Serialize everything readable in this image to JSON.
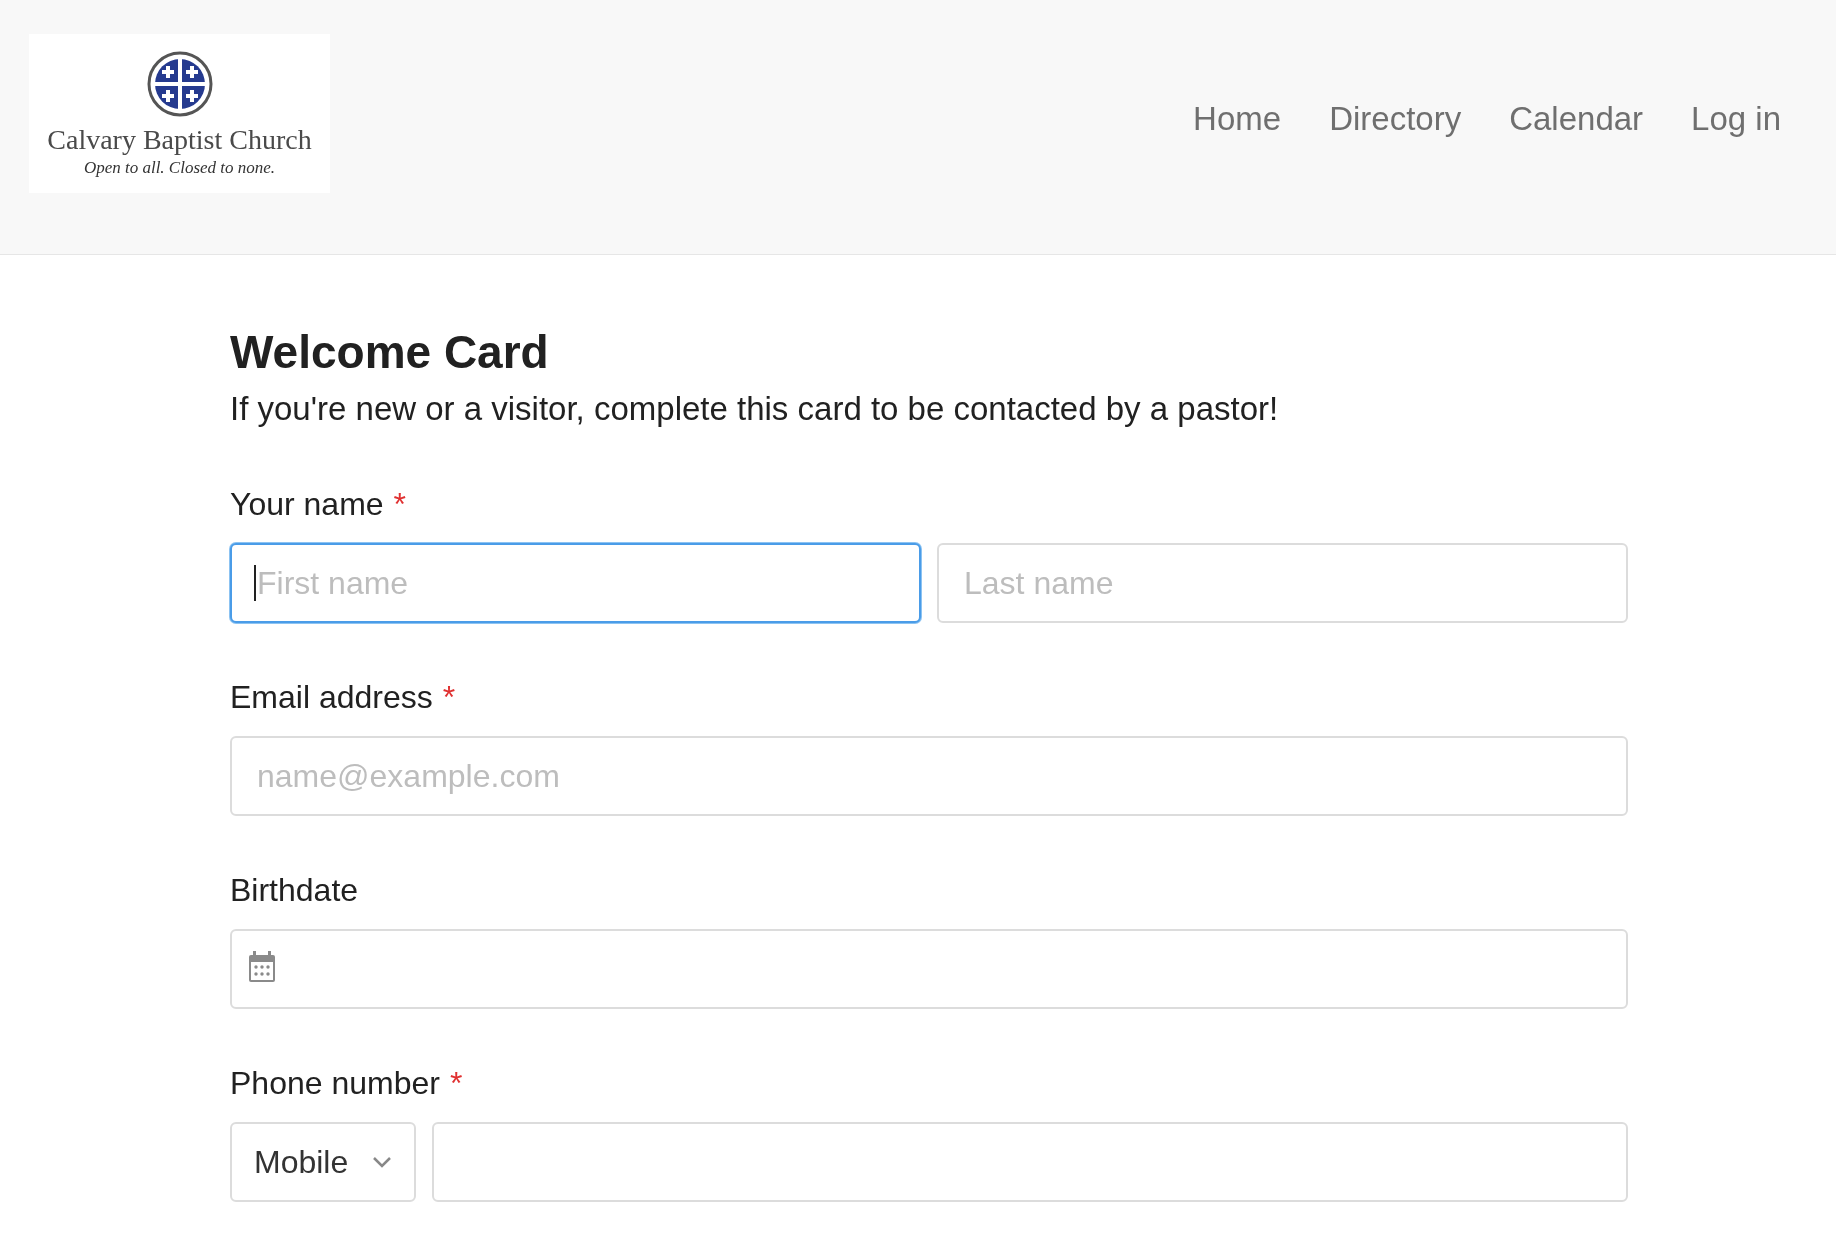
{
  "header": {
    "logo": {
      "name": "Calvary Baptist Church",
      "tagline": "Open to all. Closed to none."
    },
    "nav": [
      {
        "label": "Home"
      },
      {
        "label": "Directory"
      },
      {
        "label": "Calendar"
      },
      {
        "label": "Log in"
      }
    ]
  },
  "form": {
    "title": "Welcome Card",
    "intro": "If you're new or a visitor, complete this card to be contacted by a pastor!",
    "fields": [
      {
        "kind": "name",
        "label": "Your name",
        "required_mark": "*",
        "inputs": [
          {
            "placeholder": "First name",
            "focused": true
          },
          {
            "placeholder": "Last name",
            "focused": false
          }
        ]
      },
      {
        "kind": "text",
        "label": "Email address",
        "required_mark": "*",
        "inputs": [
          {
            "placeholder": "name@example.com",
            "focused": false
          }
        ]
      },
      {
        "kind": "date",
        "label": "Birthdate",
        "inputs": [
          {
            "focused": false
          }
        ]
      },
      {
        "kind": "phone",
        "label": "Phone number",
        "required_mark": "*",
        "select": {
          "value": "Mobile"
        },
        "inputs": [
          {
            "focused": false
          }
        ]
      }
    ]
  }
}
